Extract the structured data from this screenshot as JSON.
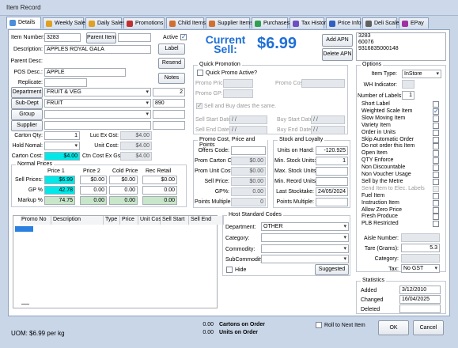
{
  "window": {
    "title": "Item Record"
  },
  "tabs": [
    {
      "label": "Details",
      "color": "#4a90d9"
    },
    {
      "label": "Weekly Sales",
      "color": "#e0a020"
    },
    {
      "label": "Daily Sales",
      "color": "#e0a020"
    },
    {
      "label": "Promotions",
      "color": "#c03030"
    },
    {
      "label": "Child Items",
      "color": "#d07030"
    },
    {
      "label": "Supplier Items",
      "color": "#d07030"
    },
    {
      "label": "Purchases",
      "color": "#30a050"
    },
    {
      "label": "Tax History",
      "color": "#7050c0"
    },
    {
      "label": "Price Info",
      "color": "#3060c0"
    },
    {
      "label": "Deli Scale",
      "color": "#606060"
    },
    {
      "label": "EPay",
      "color": "#a030a0"
    }
  ],
  "item": {
    "item_number_label": "Item Number:",
    "item_number": "3283",
    "parent_item_btn": "Parent Item",
    "parent_item": "",
    "active_label": "Active",
    "active": true,
    "description_label": "Description:",
    "description": "APPLES ROYAL GALA",
    "parent_desc_label": "Parent Desc:",
    "pos_desc_label": "POS Desc.:",
    "pos_desc": "APPLE",
    "replicate_label": "Replicate:",
    "department_btn": "Department",
    "department": "FRUIT & VEG",
    "department_num": "2",
    "subdept_btn": "Sub-Dept",
    "subdept": "FRUIT",
    "subdept_num": "890",
    "group_btn": "Group",
    "supplier_btn": "Supplier",
    "carton_qty_label": "Carton Qty:",
    "carton_qty": "1",
    "hold_nomal_label": "Hold Nomal:",
    "carton_cost_label": "Carton Cost:",
    "carton_cost": "$4.00",
    "luc_label": "Luc Ex Gst:",
    "luc": "$4.00",
    "unit_cost_label": "Unit Cost:",
    "unit_cost": "$4.00",
    "ctn_cost_label": "Ctn Cost Ex Gst:",
    "ctn_cost": "$4.00"
  },
  "buttons": {
    "label": "Label",
    "resend": "Resend",
    "notes": "Notes",
    "add_apn": "Add APN",
    "delete_apn": "Delete APN",
    "ok": "OK",
    "cancel": "Cancel",
    "suggested": "Suggested"
  },
  "current_sell": {
    "label": "Current Sell:",
    "value": "$6.99"
  },
  "apn_list": [
    "3283",
    "60076",
    "9316835000148"
  ],
  "normal_prices": {
    "title": "Normal Prices",
    "headers": [
      "Price 1",
      "Price 2",
      "Cold Price",
      "Rec Retail"
    ],
    "rows": [
      {
        "label": "Sell Prices:",
        "values": [
          "$6.99",
          "$0.00",
          "$0.00",
          "$0.00"
        ]
      },
      {
        "label": "GP %",
        "values": [
          "42.78",
          "0.00",
          "0.00",
          "0.00"
        ]
      },
      {
        "label": "Markup %",
        "values": [
          "74.75",
          "0.00",
          "0.00",
          "0.00"
        ]
      }
    ]
  },
  "quick_promo": {
    "title": "Quick Promotion",
    "active_label": "Quick Promo Active?",
    "promo_price_label": "Promo Price:",
    "promo_cost_label": "Promo Cost:",
    "promo_gp_label": "Promo GP:",
    "same_dates_label": "Sell and Buy dates the same.",
    "sell_start_label": "Sell Start Date:",
    "sell_end_label": "Sell End Date:",
    "buy_start_label": "Buy Start Date:",
    "buy_end_label": "Buy End Date:",
    "date_placeholder": "/ /"
  },
  "promo_cost": {
    "title": "Promo Cost, Price and Points",
    "offers_code_label": "Offers Code:",
    "prom_carton_label": "Prom Carton Cost:",
    "prom_carton": "$0.00",
    "prom_unit_label": "Prom Unit Cost:",
    "prom_unit": "$0.00",
    "sell_price_label": "Sell Price:",
    "sell_price": "$0.00",
    "gp_label": "GP%:",
    "gp": "0.00",
    "points_label": "Points Multiple:",
    "points": "0"
  },
  "stock": {
    "title": "Stock and Loyalty",
    "on_hand_label": "Units on Hand:",
    "on_hand": "-120.925",
    "min_label": "Min. Stock Units:",
    "min": "1",
    "max_label": "Max. Stock Units:",
    "max": "",
    "reorder_label": "Min. Reord Units:",
    "reorder": "",
    "last_take_label": "Last Stocktake:",
    "last_take": "24/05/2024",
    "points_label": "Points Multiple:",
    "points": ""
  },
  "promo_grid": {
    "headers": [
      "Promo No",
      "Description",
      "Type",
      "Price",
      "Unit Cost",
      "Sell Start",
      "Sell End"
    ]
  },
  "host_codes": {
    "title": "Host Standard Codes",
    "department_label": "Department:",
    "department": "OTHER",
    "category_label": "Category:",
    "commodity_label": "Commodity:",
    "subcommodity_label": "SubCommodity:",
    "hide_label": "Hide"
  },
  "options": {
    "title": "Options",
    "item_type_label": "Item Type:",
    "item_type": "InStore",
    "wh_label": "WH Indicator:",
    "labels_label": "Number of Labels:",
    "labels": "1",
    "checks": [
      {
        "label": "Short Label",
        "checked": false,
        "disabled": false
      },
      {
        "label": "Weighted Scale Item",
        "checked": true,
        "disabled": false
      },
      {
        "label": "Slow Moving Item",
        "checked": false,
        "disabled": false
      },
      {
        "label": "Variety Item",
        "checked": false,
        "disabled": false
      },
      {
        "label": "Order in Units",
        "checked": false,
        "disabled": false
      },
      {
        "label": "Skip Automatic Order",
        "checked": false,
        "disabled": false
      },
      {
        "label": "Do not order this Item",
        "checked": false,
        "disabled": false
      },
      {
        "label": "Open Item",
        "checked": false,
        "disabled": false
      },
      {
        "label": "QTY Enforce",
        "checked": false,
        "disabled": false
      },
      {
        "label": "Non Discountable",
        "checked": false,
        "disabled": false
      },
      {
        "label": "Non Voucher Usage",
        "checked": false,
        "disabled": false
      },
      {
        "label": "Sell by the Metre",
        "checked": false,
        "disabled": false
      },
      {
        "label": "Send Item to Elec. Labels",
        "checked": false,
        "disabled": true
      },
      {
        "label": "Fuel Item",
        "checked": false,
        "disabled": false
      },
      {
        "label": "Instruction Item",
        "checked": false,
        "disabled": false
      },
      {
        "label": "Allow Zero Price",
        "checked": false,
        "disabled": false
      },
      {
        "label": "Fresh Produce",
        "checked": false,
        "disabled": false
      },
      {
        "label": "PLB Restricted",
        "checked": false,
        "disabled": false
      }
    ],
    "aisle_label": "Aisle Number:",
    "tare_label": "Tare (Grams):",
    "tare": "5.3",
    "category_label": "Category:",
    "tax_label": "Tax:",
    "tax": "No GST"
  },
  "statistics": {
    "title": "Statistics",
    "added_label": "Added",
    "added": "3/12/2010",
    "changed_label": "Changed",
    "changed": "16/04/2025",
    "deleted_label": "Deleted"
  },
  "footer": {
    "uom": "UOM: $6.99 per kg",
    "cartons_val": "0.00",
    "cartons_label": "Cartons on Order",
    "units_val": "0.00",
    "units_label": "Units on Order",
    "roll_label": "Roll to Next Item"
  }
}
